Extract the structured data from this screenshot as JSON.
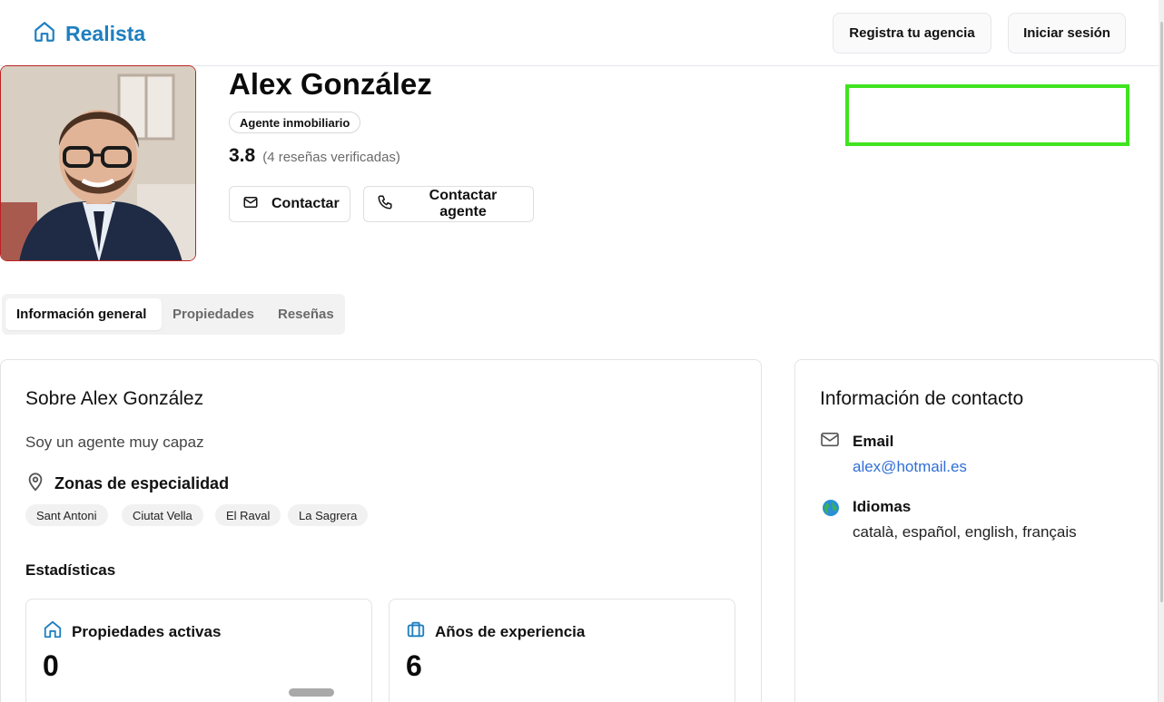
{
  "header": {
    "brand": "Realista",
    "register_label": "Registra tu agencia",
    "login_label": "Iniciar sesión"
  },
  "profile": {
    "name": "Alex González",
    "role": "Agente inmobiliario",
    "rating": "3.8",
    "reviews_text": "(4 reseñas verificadas)",
    "contact_label": "Contactar",
    "contact_agent_label": "Contactar agente"
  },
  "tabs": [
    {
      "label": "Información general",
      "active": true
    },
    {
      "label": "Propiedades",
      "active": false
    },
    {
      "label": "Reseñas",
      "active": false
    }
  ],
  "about": {
    "title": "Sobre Alex González",
    "description": "Soy un agente muy capaz",
    "zones_title": "Zonas de especialidad",
    "zones": [
      "Sant Antoni",
      "Ciutat Vella",
      "El Raval",
      "La Sagrera"
    ],
    "stats_title": "Estadísticas",
    "stats": [
      {
        "label": "Propiedades activas",
        "value": "0",
        "icon": "house-icon"
      },
      {
        "label": "Años de experiencia",
        "value": "6",
        "icon": "briefcase-icon"
      }
    ]
  },
  "contact": {
    "title": "Información de contacto",
    "email_label": "Email",
    "email_value": "alex@hotmail.es",
    "languages_label": "Idiomas",
    "languages_value": "català, español, english, français"
  },
  "colors": {
    "brand": "#1f7fbf",
    "link": "#2f6fd6",
    "highlight": "#3fe31f"
  }
}
